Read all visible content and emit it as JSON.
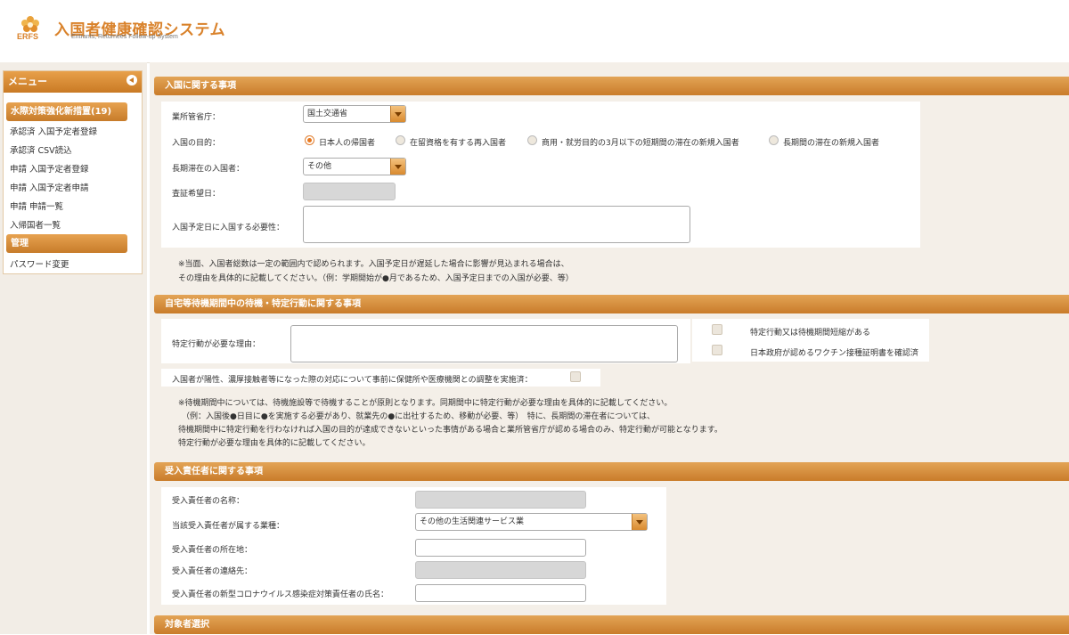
{
  "header": {
    "logo_text": "ERFS",
    "title": "入国者健康確認システム",
    "subtitle": "Entrants, Returnees Follow-up System"
  },
  "sidebar": {
    "menu_title": "メニュー",
    "category1": "水際対策強化新措置(19)",
    "items1": [
      "承認済 入国予定者登録",
      "承認済 CSV読込",
      "申請 入国予定者登録",
      "申請 入国予定者申請",
      "申請 申請一覧",
      "入帰国者一覧"
    ],
    "category2": "管理",
    "items2": [
      "パスワード変更"
    ]
  },
  "sec1": {
    "title": "入国に関する事項",
    "ministry_label": "業所管省庁：",
    "ministry_value": "国土交通省",
    "purpose_label": "入国の目的：",
    "purpose_options": [
      "日本人の帰国者",
      "在留資格を有する再入国者",
      "商用・就労目的の3月以下の短期間の滞在の新規入国者",
      "長期間の滞在の新規入国者"
    ],
    "purpose_selected": 0,
    "longstay_label": "長期滞在の入国者：",
    "longstay_value": "その他",
    "visa_label": "査証希望日：",
    "necessity_label": "入国予定日に入国する必要性：",
    "note1": "※当面、入国者総数は一定の範囲内で認められます。入国予定日が遅延した場合に影響が見込まれる場合は、",
    "note2": "その理由を具体的に記載してください。（例：学期開始が●月であるため、入国予定日までの入国が必要、等）"
  },
  "sec2": {
    "title": "自宅等待機期間中の待機・特定行動に関する事項",
    "reason_label": "特定行動が必要な理由：",
    "check1": "特定行動又は待機期間短縮がある",
    "check2": "日本政府が認めるワクチン接種証明書を確認済",
    "adjust_label": "入国者が陽性、濃厚接触者等になった際の対応について事前に保健所や医療機関との調整を実施済：",
    "note1": "※待機期間中については、待機施設等で待機することが原則となります。同期間中に特定行動が必要な理由を具体的に記載してください。",
    "note2": "（例：入国後●日目に●を実施する必要があり、就業先の●に出社するため、移動が必要、等）　特に、長期間の滞在者については、",
    "note3": "待機期間中に特定行動を行わなければ入国の目的が達成できないといった事情がある場合と業所管省庁が認める場合のみ、特定行動が可能となります。",
    "note4": "特定行動が必要な理由を具体的に記載してください。"
  },
  "sec3": {
    "title": "受入責任者に関する事項",
    "name_label": "受入責任者の名称：",
    "industry_label": "当該受入責任者が属する業種：",
    "industry_value": "その他の生活関連サービス業",
    "address_label": "受入責任者の所在地：",
    "contact_label": "受入責任者の連絡先：",
    "covid_label": "受入責任者の新型コロナウイルス感染症対策責任者の氏名："
  },
  "sec4": {
    "title": "対象者選択"
  }
}
